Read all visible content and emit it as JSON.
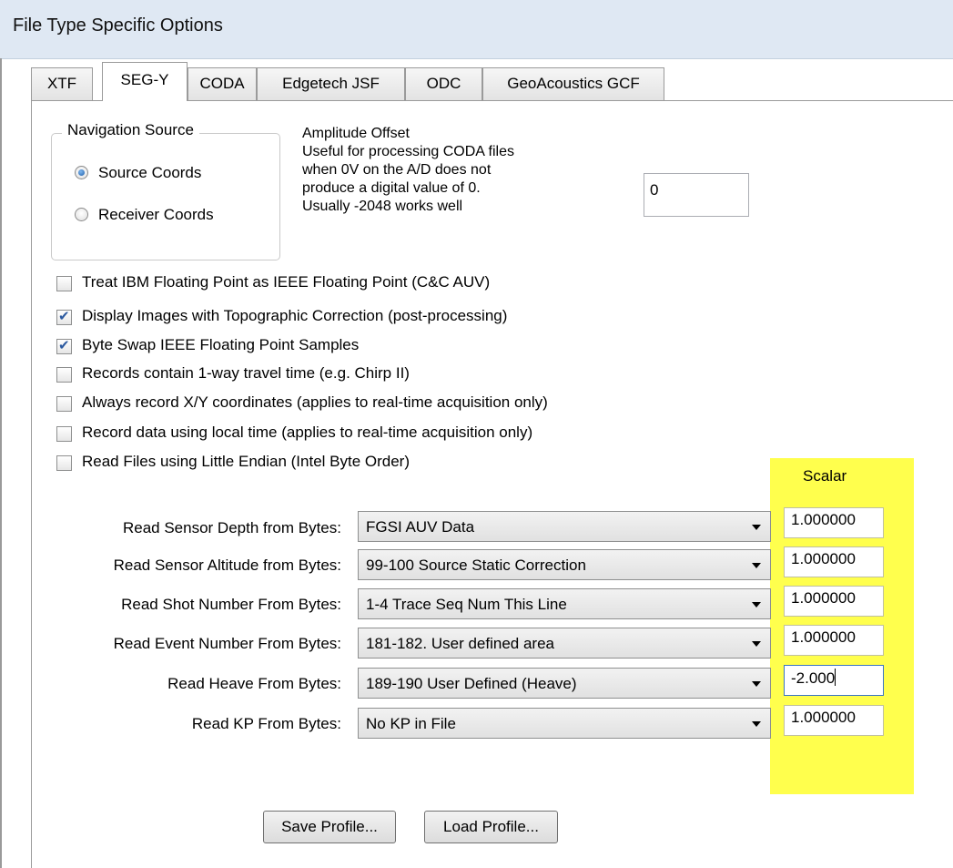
{
  "title": "File Type Specific Options",
  "tabs": [
    {
      "label": "XTF"
    },
    {
      "label": "SEG-Y"
    },
    {
      "label": "CODA"
    },
    {
      "label": "Edgetech JSF"
    },
    {
      "label": "ODC"
    },
    {
      "label": "GeoAcoustics GCF"
    }
  ],
  "active_tab": "SEG-Y",
  "navigation": {
    "legend": "Navigation Source",
    "options": [
      {
        "label": "Source Coords",
        "selected": true
      },
      {
        "label": "Receiver Coords",
        "selected": false
      }
    ]
  },
  "amplitude": {
    "lines": [
      "Amplitude Offset",
      "Useful for processing CODA files",
      "when 0V on the A/D does not",
      "produce a digital value of 0.",
      "Usually -2048 works well"
    ],
    "value": "0"
  },
  "checkboxes": [
    {
      "label": "Treat IBM Floating Point as IEEE Floating Point (C&C AUV)",
      "checked": false
    },
    {
      "label": "Display Images with Topographic Correction (post-processing)",
      "checked": true
    },
    {
      "label": "Byte Swap IEEE Floating Point Samples",
      "checked": true
    },
    {
      "label": "Records contain 1-way travel time (e.g. Chirp II)",
      "checked": false
    },
    {
      "label": "Always record X/Y coordinates (applies to real-time acquisition only)",
      "checked": false
    },
    {
      "label": "Record data using local time (applies to real-time acquisition only)",
      "checked": false
    },
    {
      "label": "Read Files using Little Endian (Intel Byte Order)",
      "checked": false
    }
  ],
  "scalar_header": "Scalar",
  "rows": [
    {
      "label": "Read Sensor Depth from Bytes:",
      "selected": "FGSI AUV Data",
      "scalar": "1.000000"
    },
    {
      "label": "Read Sensor Altitude from Bytes:",
      "selected": "99-100 Source Static Correction",
      "scalar": "1.000000"
    },
    {
      "label": "Read Shot Number From Bytes:",
      "selected": "1-4  Trace Seq Num This Line",
      "scalar": "1.000000"
    },
    {
      "label": "Read Event Number From Bytes:",
      "selected": "181-182. User defined area",
      "scalar": "1.000000"
    },
    {
      "label": "Read Heave From Bytes:",
      "selected": "189-190 User Defined (Heave)",
      "scalar": "-2.000"
    },
    {
      "label": "Read KP From Bytes:",
      "selected": "No KP in File",
      "scalar": "1.000000"
    }
  ],
  "buttons": {
    "save": "Save Profile...",
    "load": "Load Profile..."
  },
  "colors": {
    "highlight": "#ffff4d",
    "titlebar": "#dfe8f3",
    "check_accent": "#2c5aa0"
  }
}
